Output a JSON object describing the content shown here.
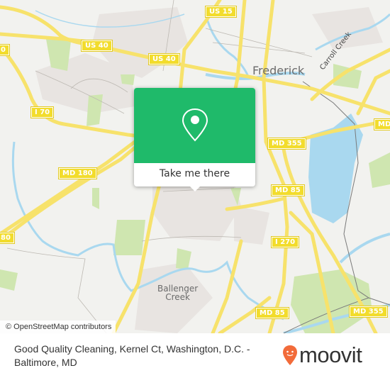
{
  "map": {
    "colors": {
      "land": "#f2f2ef",
      "urban": "#e8e4e1",
      "park": "#cfe6b0",
      "water": "#a9d8ef",
      "road": "#f7e26b",
      "shield": "#f2dc2c",
      "popup_green": "#1fba6a"
    },
    "places": [
      {
        "id": "frederick",
        "label": "Frederick"
      },
      {
        "id": "ballenger-creek",
        "label": "Ballenger\nCreek"
      }
    ],
    "water_labels": [
      {
        "id": "carroll-creek",
        "label": "Carroll Creek"
      }
    ],
    "road_shields": [
      {
        "id": "us15",
        "label": "US 15"
      },
      {
        "id": "us40-a",
        "label": "US 40"
      },
      {
        "id": "us40-b",
        "label": "US 40"
      },
      {
        "id": "us40-edge",
        "label": "0"
      },
      {
        "id": "i70",
        "label": "I 70"
      },
      {
        "id": "md180-a",
        "label": "MD 180"
      },
      {
        "id": "md180-edge",
        "label": "80"
      },
      {
        "id": "md355-a",
        "label": "MD 355"
      },
      {
        "id": "md355-b",
        "label": "MD 355"
      },
      {
        "id": "md85-a",
        "label": "MD 85"
      },
      {
        "id": "md85-b",
        "label": "MD 85"
      },
      {
        "id": "i270",
        "label": "I 270"
      },
      {
        "id": "md-edge",
        "label": "MD"
      }
    ],
    "attribution": "© OpenStreetMap contributors"
  },
  "popup": {
    "icon": "map-pin-icon",
    "cta_label": "Take me there"
  },
  "footer": {
    "address": "Good Quality Cleaning, Kernel Ct, Washington, D.C. - Baltimore, MD",
    "brand": "moovit",
    "brand_color": "#f26b3a"
  }
}
